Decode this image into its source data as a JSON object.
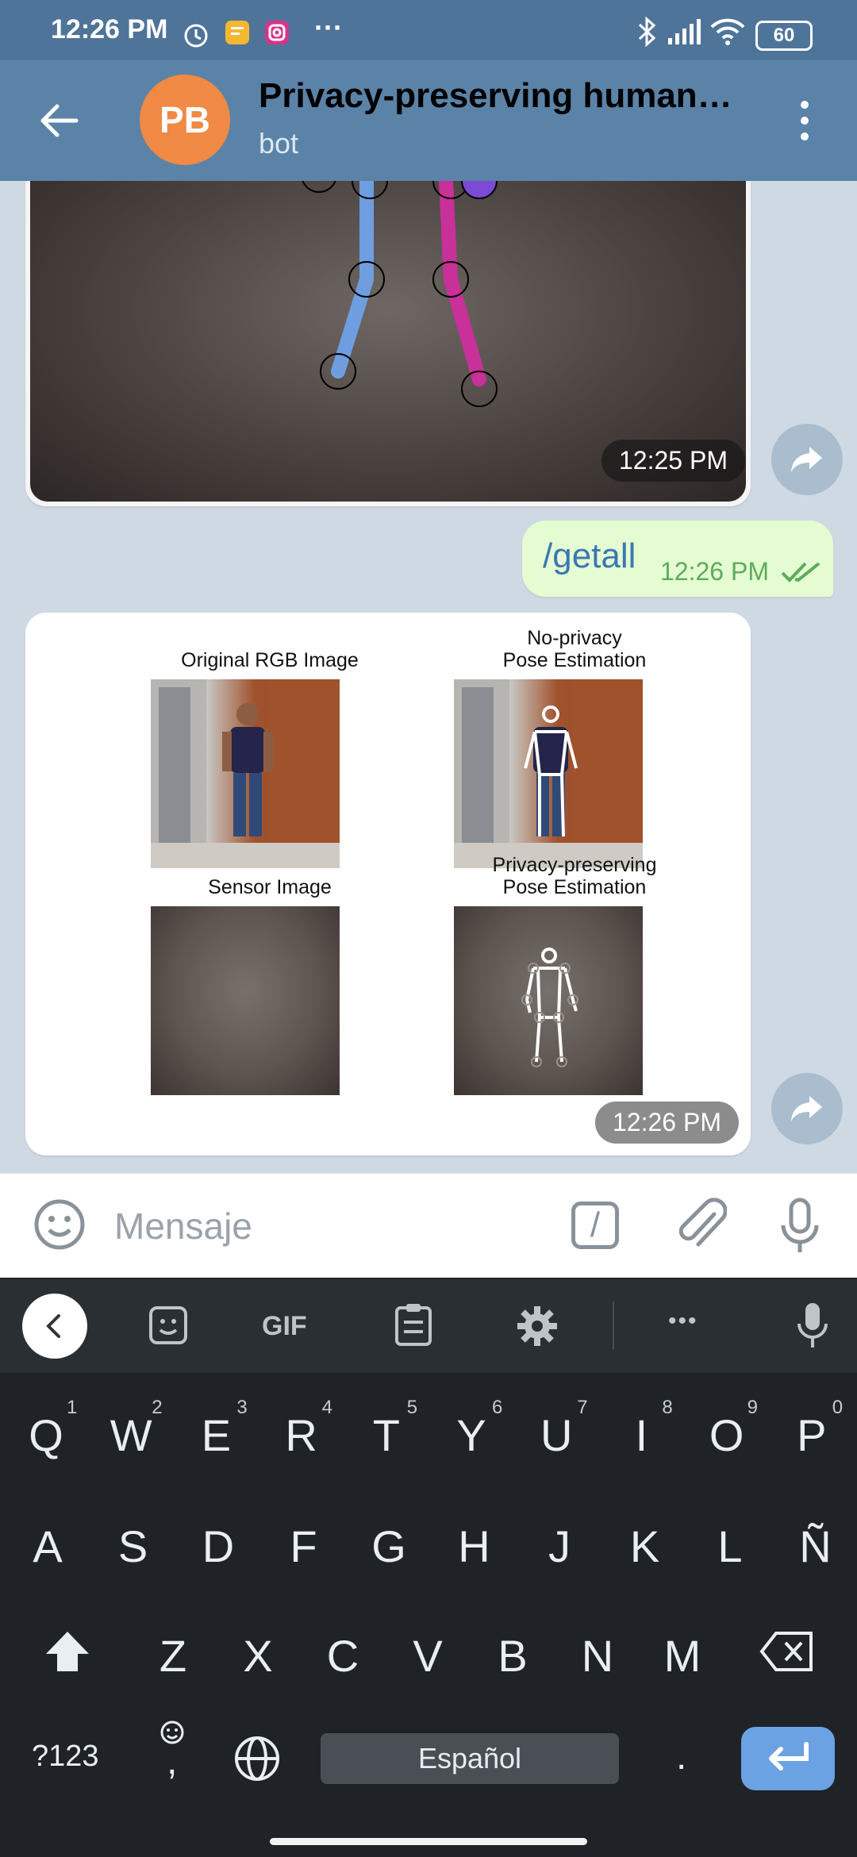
{
  "status_bar": {
    "time": "12:26 PM",
    "battery": "60",
    "more_dots": "···"
  },
  "header": {
    "avatar_initials": "PB",
    "title": "Privacy-preserving human…",
    "subtitle": "bot"
  },
  "messages": {
    "incoming_photo_time": "12:25 PM",
    "outgoing_text": "/getall",
    "outgoing_time": "12:26 PM",
    "result_time": "12:26 PM",
    "result_captions": {
      "original_rgb": "Original RGB Image",
      "no_privacy_line1": "No-privacy",
      "no_privacy_line2": "Pose Estimation",
      "sensor_image": "Sensor Image",
      "privacy_line1": "Privacy-preserving",
      "privacy_line2": "Pose Estimation"
    }
  },
  "composer": {
    "placeholder": "Mensaje",
    "slash_label": "/"
  },
  "keyboard": {
    "toolbar": {
      "gif_label": "GIF",
      "more_label": "•••"
    },
    "row1": [
      {
        "key": "Q",
        "hint": "1"
      },
      {
        "key": "W",
        "hint": "2"
      },
      {
        "key": "E",
        "hint": "3"
      },
      {
        "key": "R",
        "hint": "4"
      },
      {
        "key": "T",
        "hint": "5"
      },
      {
        "key": "Y",
        "hint": "6"
      },
      {
        "key": "U",
        "hint": "7"
      },
      {
        "key": "I",
        "hint": "8"
      },
      {
        "key": "O",
        "hint": "9"
      },
      {
        "key": "P",
        "hint": "0"
      }
    ],
    "row2": [
      "A",
      "S",
      "D",
      "F",
      "G",
      "H",
      "J",
      "K",
      "L",
      "Ñ"
    ],
    "row3": [
      "Z",
      "X",
      "C",
      "V",
      "B",
      "N",
      "M"
    ],
    "bottom": {
      "symbols_label": "?123",
      "comma_label": ",",
      "space_label": "Español",
      "period_label": "."
    }
  },
  "colors": {
    "header": "#5b83a8",
    "status_bar": "#4f7499",
    "avatar": "#f08a45",
    "outgoing_bubble": "#e5fbd1",
    "enter_key": "#6aa2e3"
  }
}
